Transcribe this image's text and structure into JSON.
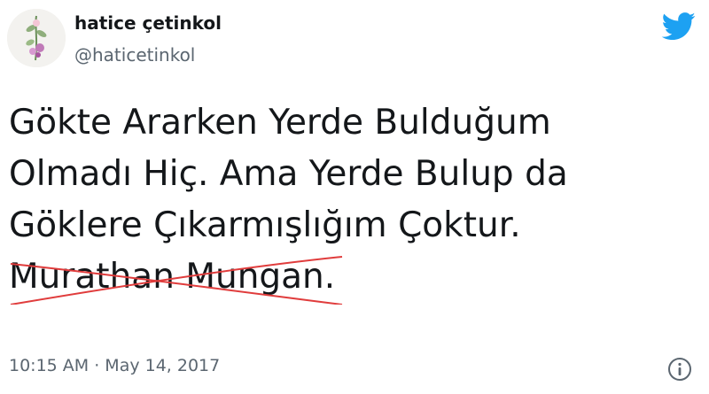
{
  "user": {
    "display_name": "hatice çetinkol",
    "handle": "@haticetinkol"
  },
  "tweet": {
    "lines": [
      "Gökte Ararken Yerde Bulduğum",
      "Olmadı Hiç. Ama Yerde Bulup da",
      "Göklere Çıkarmışlığım Çoktur.",
      "Murathan Mungan",
      "."
    ],
    "timestamp": "10:15 AM · May 14, 2017"
  },
  "icons": {
    "brand": "twitter-bird-icon",
    "info": "info-icon"
  },
  "colors": {
    "brand_blue": "#1da1f2",
    "strike_red": "#e03c3c",
    "secondary_text": "#5b6670"
  }
}
